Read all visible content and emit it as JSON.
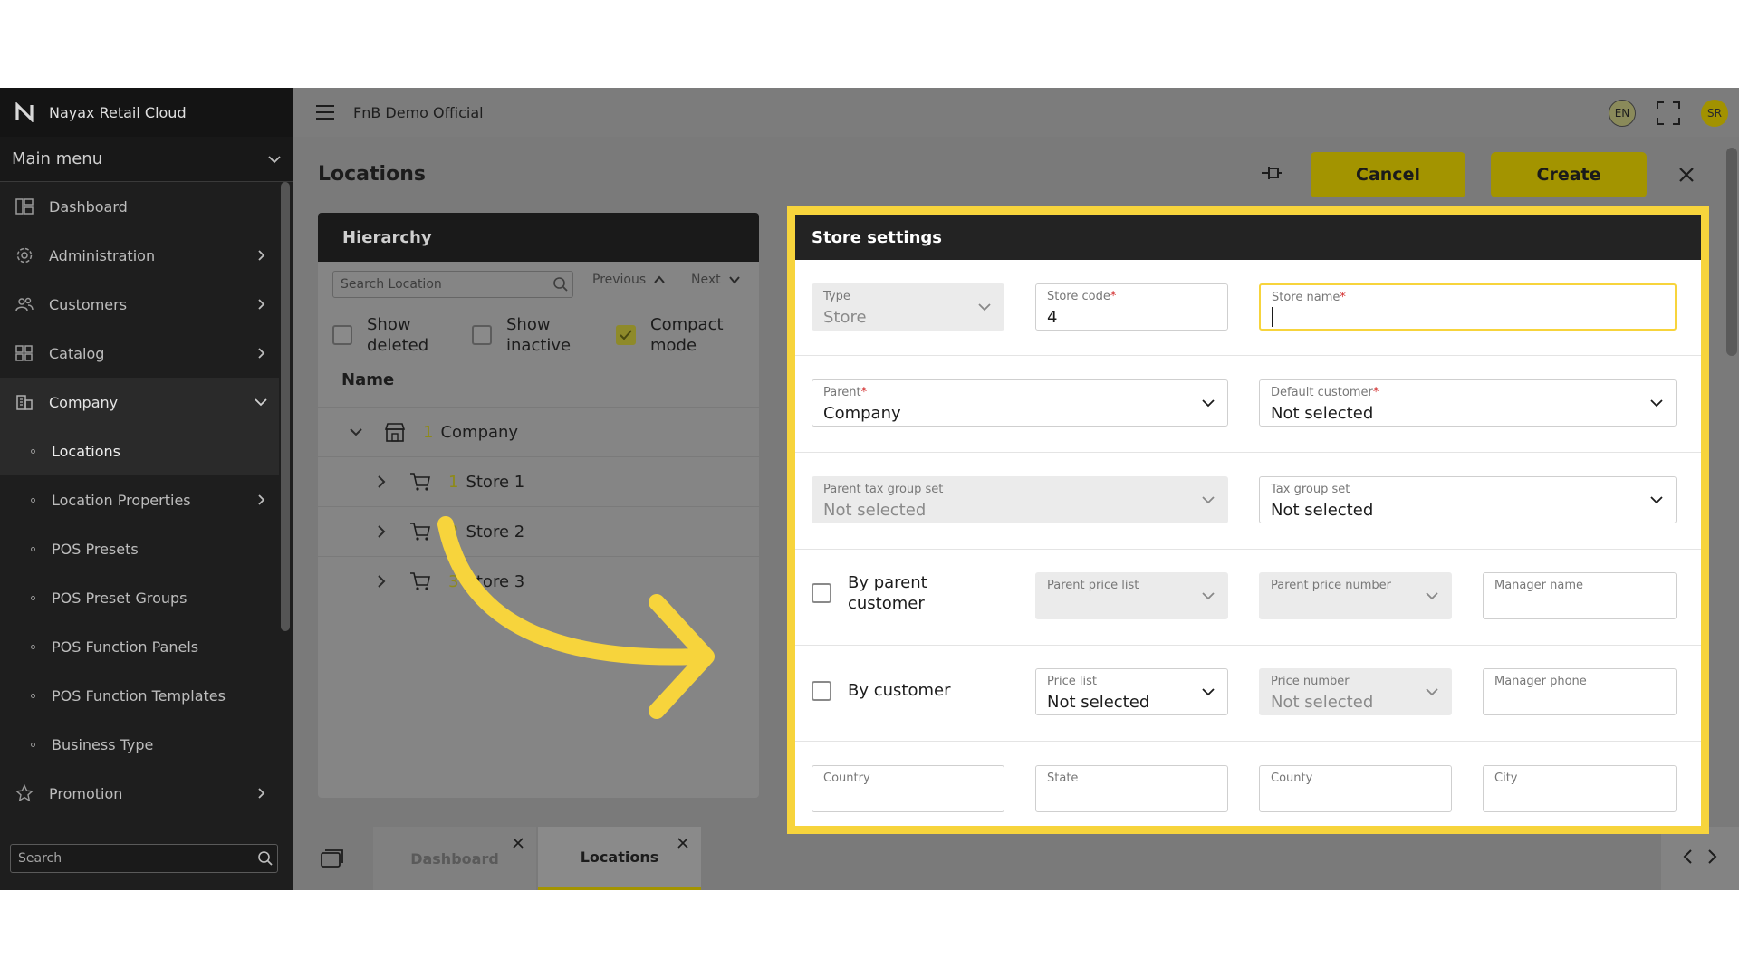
{
  "brand": {
    "name": "Nayax Retail Cloud"
  },
  "sidebar": {
    "main_menu": "Main menu",
    "items": [
      {
        "label": "Dashboard",
        "icon": "dashboard-icon"
      },
      {
        "label": "Administration",
        "icon": "gear-icon"
      },
      {
        "label": "Customers",
        "icon": "users-icon"
      },
      {
        "label": "Catalog",
        "icon": "grid-icon"
      },
      {
        "label": "Company",
        "icon": "building-icon"
      }
    ],
    "sub_items": [
      {
        "label": "Locations"
      },
      {
        "label": "Location Properties"
      },
      {
        "label": "POS Presets"
      },
      {
        "label": "POS Preset Groups"
      },
      {
        "label": "POS Function Panels"
      },
      {
        "label": "POS Function Templates"
      },
      {
        "label": "Business Type"
      }
    ],
    "promotion": {
      "label": "Promotion",
      "icon": "star-icon"
    },
    "search_placeholder": "Search"
  },
  "topbar": {
    "org_name": "FnB Demo Official",
    "language": "EN",
    "user_initials": "SR"
  },
  "page": {
    "title": "Locations",
    "cancel_label": "Cancel",
    "create_label": "Create"
  },
  "hierarchy": {
    "title": "Hierarchy",
    "search_placeholder": "Search Location",
    "previous": "Previous",
    "next": "Next",
    "checks": [
      {
        "label": "Show deleted",
        "checked": false
      },
      {
        "label": "Show inactive",
        "checked": false
      },
      {
        "label": "Compact mode",
        "checked": true
      }
    ],
    "column": "Name",
    "tree": [
      {
        "num": "1",
        "name": "Company",
        "type": "company"
      },
      {
        "num": "1",
        "name": "Store 1",
        "type": "store"
      },
      {
        "num": "2",
        "name": "Store 2",
        "type": "store"
      },
      {
        "num": "3",
        "name": "Store 3",
        "type": "store"
      }
    ]
  },
  "bottom_tabs": [
    {
      "label": "Dashboard",
      "active": false
    },
    {
      "label": "Locations",
      "active": true
    }
  ],
  "store": {
    "title": "Store settings",
    "type_label": "Type",
    "type_value": "Store",
    "code_label": "Store code",
    "code_value": "4",
    "name_label": "Store name",
    "parent_label": "Parent",
    "parent_value": "Company",
    "default_customer_label": "Default customer",
    "default_customer_value": "Not selected",
    "parent_tax_label": "Parent tax group set",
    "parent_tax_value": "Not selected",
    "tax_group_label": "Tax group set",
    "tax_group_value": "Not selected",
    "by_parent_customer": "By parent customer",
    "parent_price_list_label": "Parent price list",
    "parent_price_number_label": "Parent price number",
    "manager_name_label": "Manager name",
    "by_customer": "By customer",
    "price_list_label": "Price list",
    "price_list_value": "Not selected",
    "price_number_label": "Price number",
    "price_number_value": "Not selected",
    "manager_phone_label": "Manager phone",
    "country_label": "Country",
    "state_label": "State",
    "county_label": "County",
    "city_label": "City",
    "required_mark": "*"
  },
  "colors": {
    "accent": "#a39400",
    "highlight": "#f7d43c",
    "required": "#d32f2f"
  }
}
